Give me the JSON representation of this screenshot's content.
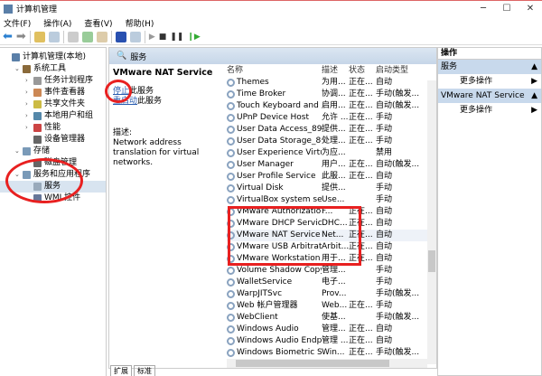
{
  "window": {
    "title": "计算机管理"
  },
  "menu": [
    "文件(F)",
    "操作(A)",
    "查看(V)",
    "帮助(H)"
  ],
  "tree": [
    {
      "label": "计算机管理(本地)",
      "level": 0,
      "chev": "",
      "color": "#5a7fa8"
    },
    {
      "label": "系统工具",
      "level": 1,
      "chev": "v",
      "color": "#8a6a3a"
    },
    {
      "label": "任务计划程序",
      "level": 2,
      "chev": ">",
      "color": "#999"
    },
    {
      "label": "事件查看器",
      "level": 2,
      "chev": ">",
      "color": "#c85"
    },
    {
      "label": "共享文件夹",
      "level": 2,
      "chev": ">",
      "color": "#cb4"
    },
    {
      "label": "本地用户和组",
      "level": 2,
      "chev": ">",
      "color": "#58a"
    },
    {
      "label": "性能",
      "level": 2,
      "chev": ">",
      "color": "#c44"
    },
    {
      "label": "设备管理器",
      "level": 2,
      "chev": "",
      "color": "#666"
    },
    {
      "label": "存储",
      "level": 1,
      "chev": "v",
      "color": "#7a9ab8"
    },
    {
      "label": "磁盘管理",
      "level": 2,
      "chev": "",
      "color": "#666"
    },
    {
      "label": "服务和应用程序",
      "level": 1,
      "chev": "v",
      "color": "#7a9ab8"
    },
    {
      "label": "服务",
      "level": 2,
      "chev": "",
      "color": "#9ab",
      "selected": true
    },
    {
      "label": "WMI 控件",
      "level": 2,
      "chev": "",
      "color": "#679"
    }
  ],
  "panel": {
    "title": "服务",
    "service_name": "VMware NAT Service",
    "stop_link": "停止",
    "stop_suffix": "此服务",
    "restart_link": "重启动",
    "restart_suffix": "此服务",
    "desc_label": "描述:",
    "description": "Network address translation for virtual networks."
  },
  "columns": [
    "名称",
    "描述",
    "状态",
    "启动类型"
  ],
  "services": [
    [
      "Themes",
      "为用...",
      "正在...",
      "自动"
    ],
    [
      "Time Broker",
      "协调...",
      "正在...",
      "手动(触发..."
    ],
    [
      "Touch Keyboard and Ha...",
      "启用...",
      "正在...",
      "自动(触发..."
    ],
    [
      "UPnP Device Host",
      "允许 ...",
      "正在...",
      "手动"
    ],
    [
      "User Data Access_89926",
      "提供...",
      "正在...",
      "手动"
    ],
    [
      "User Data Storage_89926",
      "处理...",
      "正在...",
      "手动"
    ],
    [
      "User Experience Virtualiz...",
      "为应...",
      "",
      "禁用"
    ],
    [
      "User Manager",
      "用户...",
      "正在...",
      "自动(触发..."
    ],
    [
      "User Profile Service",
      "此服...",
      "正在...",
      "自动"
    ],
    [
      "Virtual Disk",
      "提供...",
      "",
      "手动"
    ],
    [
      "VirtualBox system service",
      "Use...",
      "",
      "手动"
    ],
    [
      "VMware Authorization Service",
      "F...",
      "正在...",
      "自动"
    ],
    [
      "VMware DHCP Service",
      "DHC...",
      "正在...",
      "自动"
    ],
    [
      "VMware NAT Service",
      "Net...",
      "正在...",
      "自动"
    ],
    [
      "VMware USB Arbitration ...",
      "Arbit...",
      "正在...",
      "自动"
    ],
    [
      "VMware Workstation Ser...",
      "用于...",
      "正在...",
      "自动"
    ],
    [
      "Volume Shadow Copy",
      "管理...",
      "",
      "手动"
    ],
    [
      "WalletService",
      "电子...",
      "",
      "手动"
    ],
    [
      "WarpJITSvc",
      "Prov...",
      "",
      "手动(触发..."
    ],
    [
      "Web 帐户管理器",
      "Web...",
      "正在...",
      "手动"
    ],
    [
      "WebClient",
      "使基...",
      "",
      "手动(触发..."
    ],
    [
      "Windows Audio",
      "管理...",
      "正在...",
      "自动"
    ],
    [
      "Windows Audio Endpoint...",
      "管理 ...",
      "正在...",
      "自动"
    ],
    [
      "Windows Biometric Servi...",
      "Win...",
      "正在...",
      "手动(触发..."
    ]
  ],
  "selected_service": "VMware NAT Service",
  "actions": {
    "header": "操作",
    "sections": [
      {
        "title": "服务",
        "item": "更多操作"
      },
      {
        "title": "VMware NAT Service",
        "item": "更多操作"
      }
    ]
  },
  "tabs": [
    "扩展",
    "标准"
  ],
  "annotation_color": "#e82020"
}
